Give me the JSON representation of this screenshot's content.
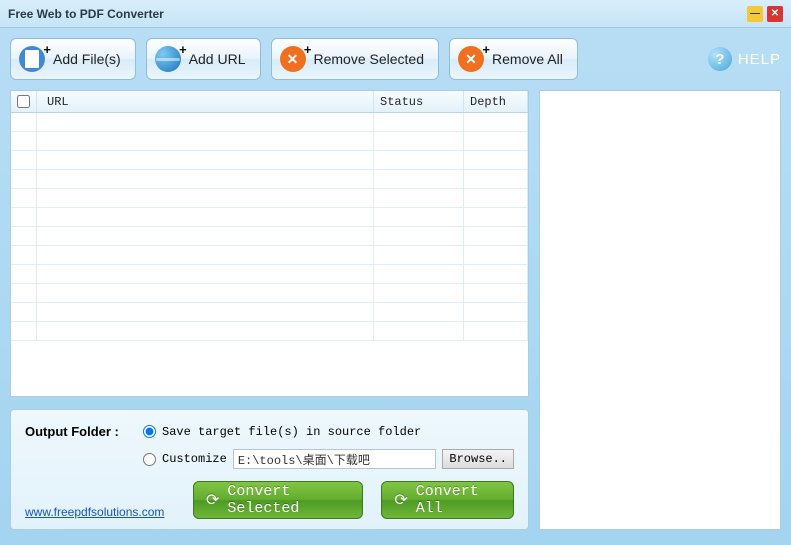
{
  "titlebar": {
    "title": "Free Web to PDF Converter"
  },
  "toolbar": {
    "add_files": "Add File(s)",
    "add_url": "Add URL",
    "remove_selected": "Remove Selected",
    "remove_all": "Remove All",
    "help": "HELP"
  },
  "table": {
    "columns": {
      "url": "URL",
      "status": "Status",
      "depth": "Depth"
    }
  },
  "output": {
    "label": "Output Folder :",
    "option_source": "Save target file(s) in source folder",
    "option_customize": "Customize",
    "path_value": "E:\\tools\\桌面\\下载吧",
    "browse": "Browse..",
    "selected_option": "source"
  },
  "actions": {
    "convert_selected": "Convert Selected",
    "convert_all": "Convert All"
  },
  "footer": {
    "link": "www.freepdfsolutions.com"
  }
}
